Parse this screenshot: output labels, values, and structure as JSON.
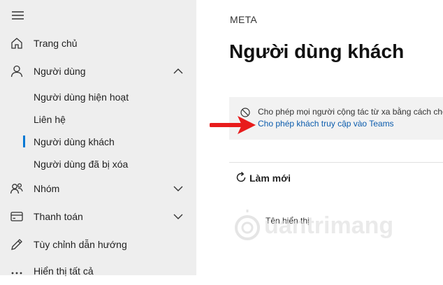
{
  "sidebar": {
    "items": [
      {
        "label": "Trang chủ",
        "icon": "home-icon"
      },
      {
        "label": "Người dùng",
        "icon": "person-icon",
        "expanded": true,
        "children": [
          {
            "label": "Người dùng hiện hoạt"
          },
          {
            "label": "Liên hệ"
          },
          {
            "label": "Người dùng khách",
            "active": true
          },
          {
            "label": "Người dùng đã bị xóa"
          }
        ]
      },
      {
        "label": "Nhóm",
        "icon": "group-icon"
      },
      {
        "label": "Thanh toán",
        "icon": "credit-card-icon"
      },
      {
        "label": "Tùy chỉnh dẫn hướng",
        "icon": "pencil-icon"
      },
      {
        "label": "Hiển thị tất cả",
        "icon": "ellipsis-icon"
      }
    ]
  },
  "main": {
    "org_name": "META",
    "title": "Người dùng khách",
    "info": {
      "message": "Cho phép mọi người cộng tác từ xa bằng cách cho",
      "link": "Cho phép khách truy cập vào Teams"
    },
    "refresh_label": "Làm mới",
    "table": {
      "columns": [
        "Tên hiển thị"
      ]
    }
  },
  "watermark": {
    "text": "uantrimang"
  },
  "colors": {
    "sidebar_bg": "#eeeeee",
    "accent": "#0078d4",
    "link": "#0b5cad",
    "arrow": "#e81c1c",
    "info_bg": "#f2f2f2"
  }
}
